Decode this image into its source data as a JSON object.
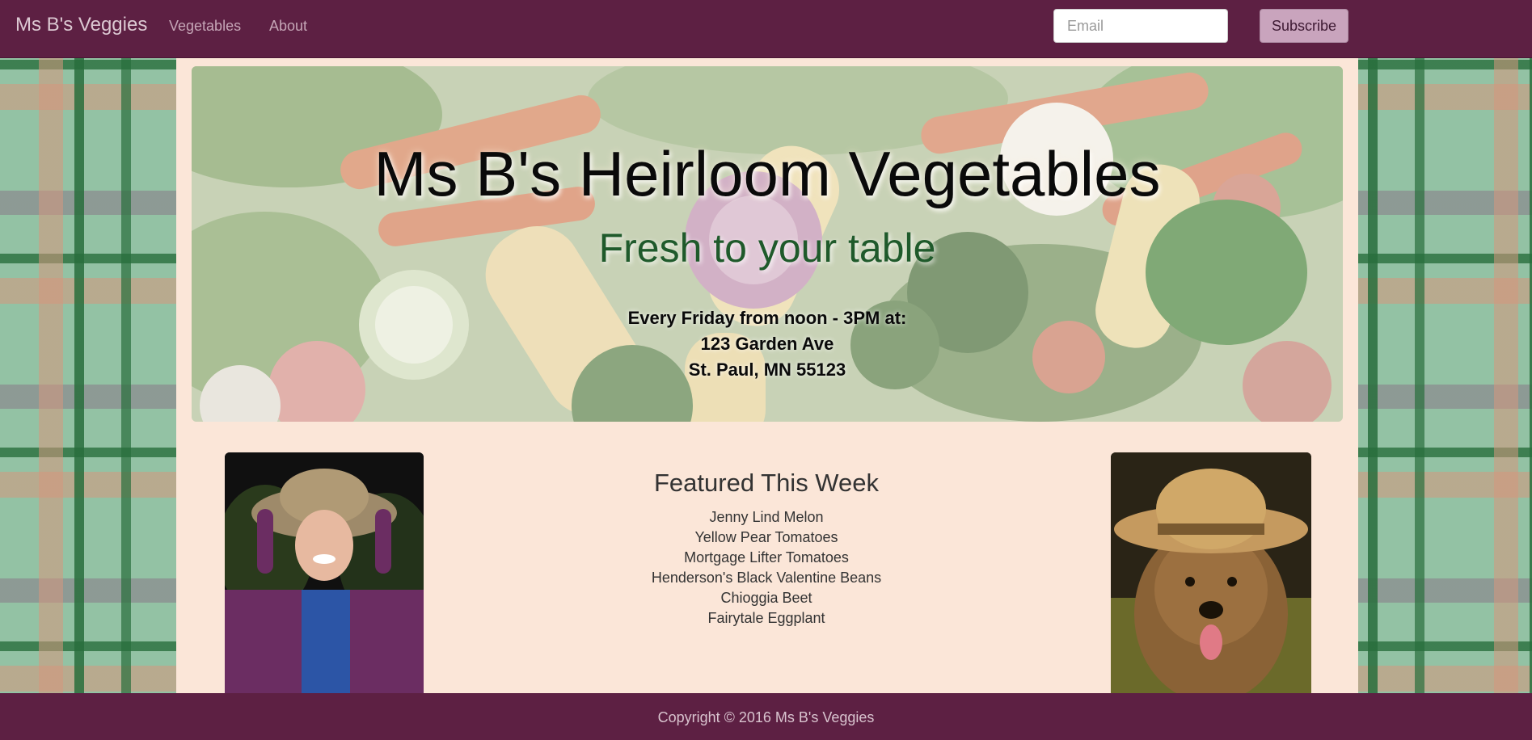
{
  "navbar": {
    "brand": "Ms B's Veggies",
    "links": [
      "Vegetables",
      "About"
    ],
    "email_placeholder": "Email",
    "subscribe_label": "Subscribe"
  },
  "hero": {
    "title": "Ms B's Heirloom Vegetables",
    "subtitle": "Fresh to your table",
    "info": [
      "Every Friday from noon - 3PM at:",
      "123 Garden Ave",
      "St. Paul, MN 55123"
    ]
  },
  "featured": {
    "heading": "Featured This Week",
    "items": [
      "Jenny Lind Melon",
      "Yellow Pear Tomatoes",
      "Mortgage Lifter Tomatoes",
      "Henderson's Black Valentine Beans",
      "Chioggia Beet",
      "Fairytale Eggplant"
    ]
  },
  "footer": {
    "copyright": "Copyright © 2016 Ms B's Veggies"
  },
  "colors": {
    "navbar": "#5d2043",
    "content_bg": "#fbe6d8",
    "subscribe_bg": "#c9a4bd",
    "subtitle_green": "#1f5a2b"
  }
}
